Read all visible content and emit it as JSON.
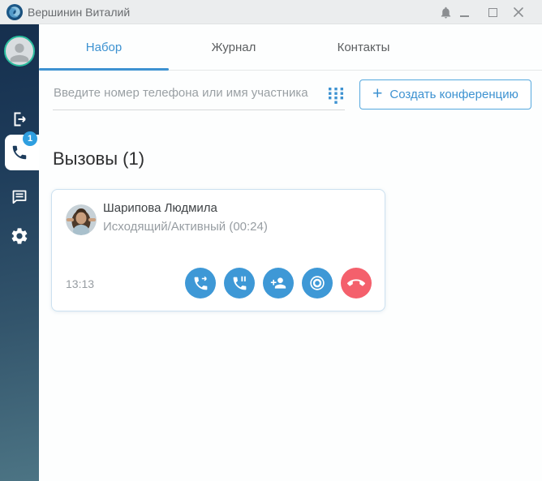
{
  "window": {
    "title": "Вершинин Виталий"
  },
  "sidebar": {
    "phone_badge": "1"
  },
  "tabs": [
    {
      "label": "Набор",
      "active": true
    },
    {
      "label": "Журнал",
      "active": false
    },
    {
      "label": "Контакты",
      "active": false
    }
  ],
  "search": {
    "placeholder": "Введите номер телефона или имя участника"
  },
  "toolbar": {
    "plus_glyph": "+",
    "create_conference_label": "Создать конференцию"
  },
  "calls": {
    "heading": "Вызовы (1)",
    "items": [
      {
        "name": "Шарипова Людмила",
        "status": "Исходящий/Активный (00:24)",
        "time": "13:13"
      }
    ]
  },
  "colors": {
    "accent_blue": "#3d92d1",
    "action_button_blue": "#3e98d6",
    "hangup_red": "#f4606c",
    "badge_blue": "#2f9fe0",
    "avatar_ring_green": "#2abd9e",
    "sidebar_gradient_top": "#152f4e",
    "sidebar_gradient_bottom": "#4c7484",
    "titlebar_bg": "#ebedee"
  }
}
